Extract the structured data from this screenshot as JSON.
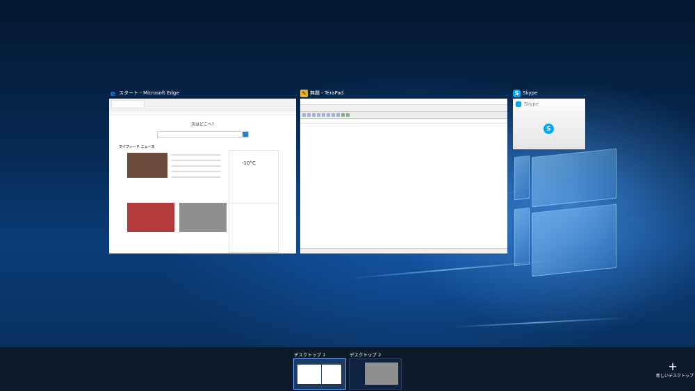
{
  "windows": [
    {
      "id": "edge",
      "title": "スタート - Microsoft Edge",
      "icon": "edge-icon",
      "accent": "#1e7bd6",
      "content": {
        "heading": "次はどこへ?",
        "feed_title": "マイフィード ニュース",
        "temperature": "-10°C"
      }
    },
    {
      "id": "terapad",
      "title": "無題 - TeraPad",
      "icon": "terapad-icon",
      "accent": "#e2b13b"
    },
    {
      "id": "skype",
      "title": "Skype",
      "icon": "skype-icon",
      "accent": "#00a9f0",
      "content": {
        "app_name": "Skype"
      }
    }
  ],
  "virtual_desktops": [
    {
      "label": "デスクトップ 1",
      "active": true
    },
    {
      "label": "デスクトップ 2",
      "active": false
    }
  ],
  "new_desktop": {
    "label": "新しいデスクトップ",
    "icon": "plus-icon"
  },
  "colors": {
    "active_outline": "#5aa0ff",
    "bottom_bar": "#0d1a2c"
  }
}
